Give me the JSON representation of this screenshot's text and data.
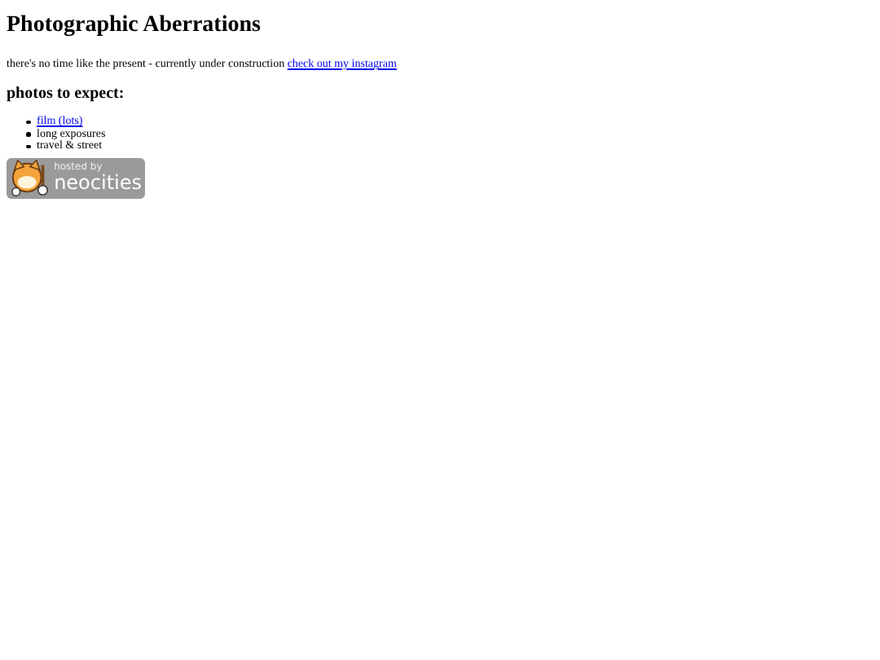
{
  "title": "Photographic Aberrations",
  "intro": {
    "text": "there's no time like the present - currently under construction",
    "link": "check out my instagram"
  },
  "section_heading": "photos to expect:",
  "items": [
    {
      "text": "film (lots)",
      "kind": "link"
    },
    {
      "text": "long exposures",
      "kind": "plain"
    },
    {
      "text": "travel & street",
      "kind": "plain"
    }
  ],
  "badge": {
    "line_1": "hosted by",
    "line_2": "neocities"
  }
}
